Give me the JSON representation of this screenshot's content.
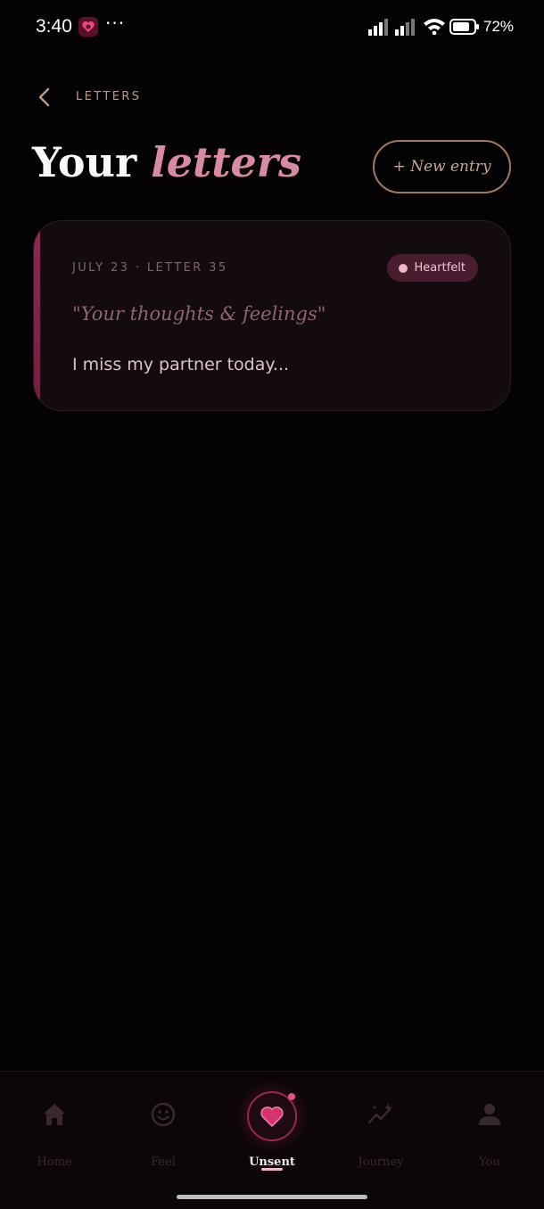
{
  "status_bar": {
    "time": "3:40",
    "more": "···",
    "battery": "72%"
  },
  "header": {
    "breadcrumb": "LETTERS",
    "title_main": "Your",
    "title_accent": "letters",
    "new_entry_label": "+ New entry"
  },
  "letters": [
    {
      "meta": "JULY 23 · LETTER 35",
      "mood": "Heartfelt",
      "prompt": "\"Your thoughts & feelings\"",
      "body": "I miss my partner today..."
    }
  ],
  "nav": {
    "items": [
      {
        "label": "Home",
        "icon": "home-icon"
      },
      {
        "label": "Feel",
        "icon": "smiley-icon"
      },
      {
        "label": "Unsent",
        "icon": "heart-icon",
        "active": true
      },
      {
        "label": "Journey",
        "icon": "trend-sparkle-icon"
      },
      {
        "label": "You",
        "icon": "person-icon"
      }
    ]
  },
  "colors": {
    "accent": "#d88aa0",
    "background": "#050204",
    "badge": "#4a1c30"
  }
}
